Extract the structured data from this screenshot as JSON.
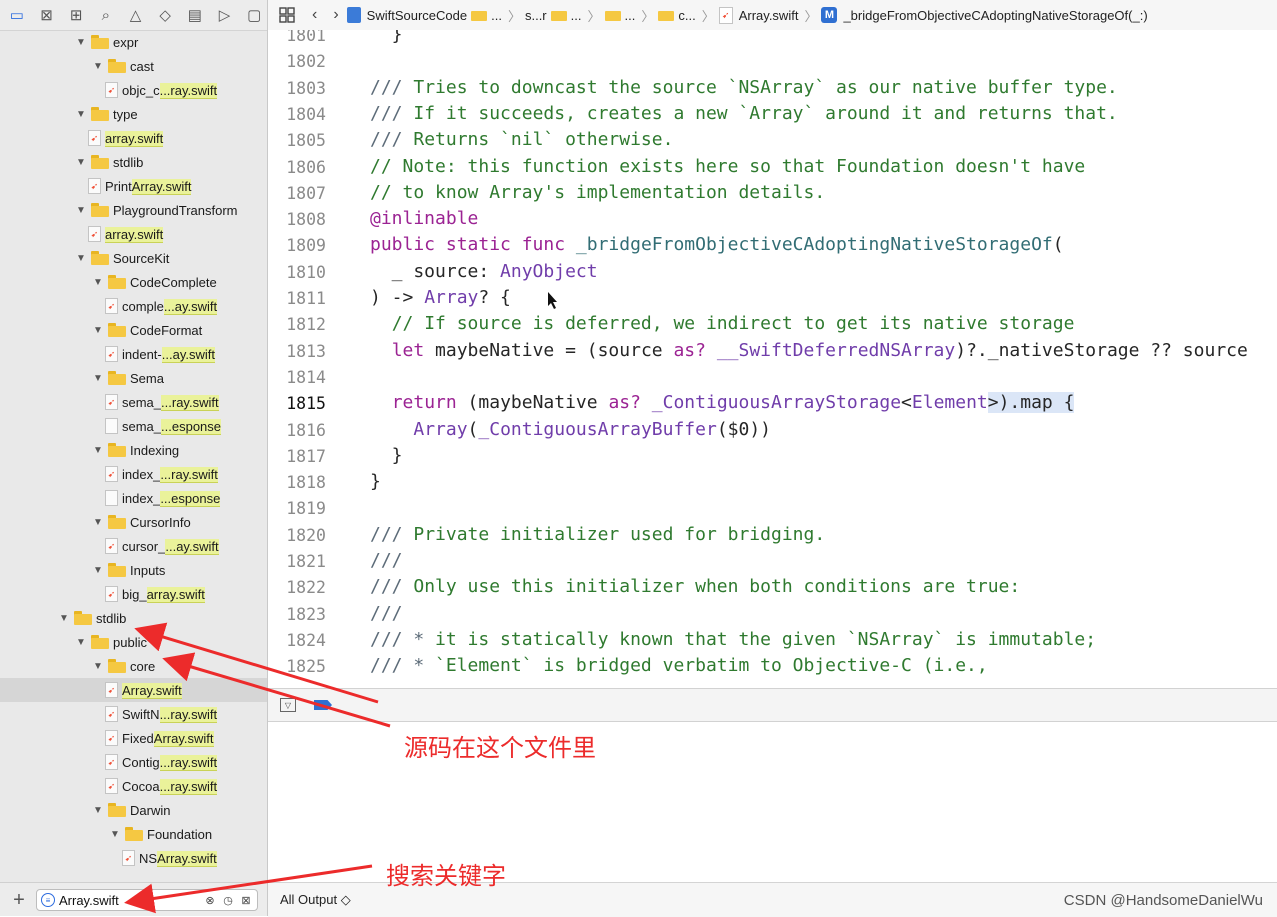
{
  "sidebar": {
    "nav_tabs": [
      "project-navigator-icon",
      "source-control-icon",
      "symbol-navigator-icon",
      "find-icon",
      "issue-icon",
      "test-icon",
      "debug-icon",
      "breakpoint-icon",
      "report-icon"
    ],
    "tree": [
      {
        "type": "folder",
        "name": "expr",
        "indent": 1
      },
      {
        "type": "folder",
        "name": "cast",
        "indent": 2
      },
      {
        "type": "file",
        "pre": "objc_c",
        "hl": "...ray.swift",
        "indent": 3
      },
      {
        "type": "folder",
        "name": "type",
        "indent": 1
      },
      {
        "type": "file",
        "pre": "",
        "hl": "array.swift",
        "indent": 2
      },
      {
        "type": "folder",
        "name": "stdlib",
        "indent": 1
      },
      {
        "type": "file",
        "pre": "Print",
        "hl": "Array.swift",
        "indent": 2
      },
      {
        "type": "folder",
        "name": "PlaygroundTransform",
        "indent": 1
      },
      {
        "type": "file",
        "pre": "",
        "hl": "array.swift",
        "indent": 2
      },
      {
        "type": "folder",
        "name": "SourceKit",
        "indent": 1
      },
      {
        "type": "folder",
        "name": "CodeComplete",
        "indent": 2
      },
      {
        "type": "file",
        "pre": "comple",
        "hl": "...ay.swift",
        "indent": 3
      },
      {
        "type": "folder",
        "name": "CodeFormat",
        "indent": 2
      },
      {
        "type": "file",
        "pre": "indent-",
        "hl": "...ay.swift",
        "indent": 3
      },
      {
        "type": "folder",
        "name": "Sema",
        "indent": 2
      },
      {
        "type": "file",
        "pre": "sema_",
        "hl": "...ray.swift",
        "indent": 3
      },
      {
        "type": "plain",
        "pre": "sema_",
        "hl": "...esponse",
        "indent": 3
      },
      {
        "type": "folder",
        "name": "Indexing",
        "indent": 2
      },
      {
        "type": "file",
        "pre": "index_",
        "hl": "...ray.swift",
        "indent": 3
      },
      {
        "type": "plain",
        "pre": "index_",
        "hl": "...esponse",
        "indent": 3
      },
      {
        "type": "folder",
        "name": "CursorInfo",
        "indent": 2
      },
      {
        "type": "file",
        "pre": "cursor_",
        "hl": "...ay.swift",
        "indent": 3
      },
      {
        "type": "folder",
        "name": "Inputs",
        "indent": 2
      },
      {
        "type": "file",
        "pre": "big_",
        "hl": "array.swift",
        "indent": 3
      },
      {
        "type": "folder",
        "name": "stdlib",
        "indent": 0
      },
      {
        "type": "folder",
        "name": "public",
        "indent": 1
      },
      {
        "type": "folder",
        "name": "core",
        "indent": 2
      },
      {
        "type": "file",
        "pre": "",
        "hl": "Array.swift",
        "indent": 3,
        "selected": true
      },
      {
        "type": "file",
        "pre": "SwiftN",
        "hl": "...ray.swift",
        "indent": 3
      },
      {
        "type": "file",
        "pre": "Fixed",
        "hl": "Array.swift",
        "indent": 3
      },
      {
        "type": "file",
        "pre": "Contig",
        "hl": "...ray.swift",
        "indent": 3
      },
      {
        "type": "file",
        "pre": "Cocoa",
        "hl": "...ray.swift",
        "indent": 3
      },
      {
        "type": "folder",
        "name": "Darwin",
        "indent": 2
      },
      {
        "type": "folder",
        "name": "Foundation",
        "indent": 3
      },
      {
        "type": "file",
        "pre": "NS",
        "hl": "Array.swift",
        "indent": 4
      }
    ],
    "filter": {
      "value": "Array.swift",
      "add": "+"
    }
  },
  "jumpbar": {
    "project": "SwiftSourceCode",
    "crumbs": [
      "...",
      "s...r",
      "...",
      "...",
      "c..."
    ],
    "file": "Array.swift",
    "method_badge": "M",
    "method": "_bridgeFromObjectiveCAdoptingNativeStorageOf(_:)"
  },
  "editor": {
    "current_line": "1815",
    "lines": [
      {
        "n": "1801",
        "html": "  }"
      },
      {
        "n": "1802",
        "html": ""
      },
      {
        "n": "1803",
        "html": "<span class=\"comment\">/// </span><span class=\"doc\">Tries to downcast the source `NSArray` as our native buffer type.</span>"
      },
      {
        "n": "1804",
        "html": "<span class=\"comment\">/// </span><span class=\"doc\">If it succeeds, creates a new `Array` around it and returns that.</span>"
      },
      {
        "n": "1805",
        "html": "<span class=\"comment\">/// </span><span class=\"doc\">Returns `nil` otherwise.</span>"
      },
      {
        "n": "1806",
        "html": "<span class=\"doc\">// Note: this function exists here so that Foundation doesn't have</span>"
      },
      {
        "n": "1807",
        "html": "<span class=\"doc\">// to know Array's implementation details.</span>"
      },
      {
        "n": "1808",
        "html": "<span class=\"kw\">@inlinable</span>"
      },
      {
        "n": "1809",
        "html": "<span class=\"kw\">public static func</span> <span class=\"fn\">_bridgeFromObjectiveCAdoptingNativeStorageOf</span>("
      },
      {
        "n": "1810",
        "html": "  _ source: <span class=\"ty\">AnyObject</span>"
      },
      {
        "n": "1811",
        "html": ") -> <span class=\"ty\">Array</span>? {"
      },
      {
        "n": "1812",
        "html": "  <span class=\"doc\">// If source is deferred, we indirect to get its native storage</span>"
      },
      {
        "n": "1813",
        "html": "  <span class=\"kw\">let</span> maybeNative = (source <span class=\"kw\">as?</span> <span class=\"ty\">__SwiftDeferredNSArray</span>)?._nativeStorage ?? source"
      },
      {
        "n": "1814",
        "html": ""
      },
      {
        "n": "1815",
        "html": "  <span class=\"kw\">return</span> (maybeNative <span class=\"kw\">as?</span> <span class=\"ty\">_ContiguousArrayStorage</span>&lt;<span class=\"ty\">Element</span><span class=\"sel\">&gt;).map {</span>"
      },
      {
        "n": "1816",
        "html": "    <span class=\"ty\">Array</span>(<span class=\"ty\">_ContiguousArrayBuffer</span>($0))"
      },
      {
        "n": "1817",
        "html": "  }"
      },
      {
        "n": "1818",
        "html": "}"
      },
      {
        "n": "1819",
        "html": ""
      },
      {
        "n": "1820",
        "html": "<span class=\"comment\">/// </span><span class=\"doc\">Private initializer used for bridging.</span>"
      },
      {
        "n": "1821",
        "html": "<span class=\"comment\">///</span>"
      },
      {
        "n": "1822",
        "html": "<span class=\"comment\">/// </span><span class=\"doc\">Only use this initializer when both conditions are true:</span>"
      },
      {
        "n": "1823",
        "html": "<span class=\"comment\">///</span>"
      },
      {
        "n": "1824",
        "html": "<span class=\"comment\">/// * </span><span class=\"doc\">it is statically known that the given `NSArray` is immutable;</span>"
      },
      {
        "n": "1825",
        "html": "<span class=\"comment\">/// * </span><span class=\"doc\">`Element` is bridged verbatim to Objective-C (i.e.,</span>"
      }
    ]
  },
  "console": {
    "output_select": "All Output ◇",
    "watermark": "CSDN @HandsomeDanielWu"
  },
  "annotations": {
    "source_note": "源码在这个文件里",
    "search_note": "搜索关键字"
  },
  "colors": {
    "annotation": "#ec2b2b",
    "highlight": "#eaf29a",
    "selection": "#dbe6f7"
  }
}
